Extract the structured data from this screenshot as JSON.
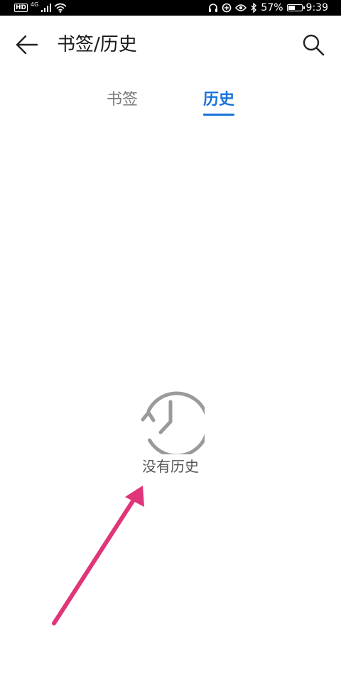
{
  "status_bar": {
    "hd": "HD",
    "network": "4G",
    "battery_percent": "57%",
    "battery_level": 0.57,
    "time": "9:39"
  },
  "header": {
    "title": "书签/历史",
    "back_icon": "arrow-left-icon",
    "search_icon": "search-icon"
  },
  "tabs": [
    {
      "label": "书签",
      "active": false
    },
    {
      "label": "历史",
      "active": true
    }
  ],
  "empty_state": {
    "icon": "history-clock-icon",
    "text": "没有历史"
  },
  "colors": {
    "accent": "#1a73d9",
    "inactive_tab": "#7a7a7a",
    "icon_gray": "#9a9a9a",
    "annotation": "#e0357a"
  }
}
